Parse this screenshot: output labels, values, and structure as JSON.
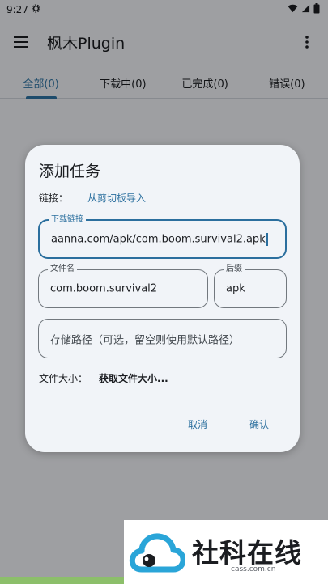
{
  "status": {
    "time": "9:27"
  },
  "appbar": {
    "title": "枫木Plugin"
  },
  "tabs": [
    {
      "label": "全部(0)"
    },
    {
      "label": "下载中(0)"
    },
    {
      "label": "已完成(0)"
    },
    {
      "label": "错误(0)"
    }
  ],
  "dialog": {
    "title": "添加任务",
    "link_label": "链接：",
    "link_action": "从剪切板导入",
    "url_field": {
      "label": "下载链接",
      "value": "aanna.com/apk/com.boom.survival2.apk"
    },
    "filename_field": {
      "label": "文件名",
      "value": "com.boom.survival2"
    },
    "ext_field": {
      "label": "后缀",
      "value": "apk"
    },
    "path_field": {
      "placeholder": "存储路径（可选，留空则使用默认路径）"
    },
    "size_label": "文件大小：",
    "size_value": "获取文件大小...",
    "cancel_label": "取消",
    "confirm_label": "确认"
  },
  "watermark": {
    "brand": "社科在线",
    "domain": "cass.com.cn"
  },
  "colors": {
    "accent": "#2b6f9e",
    "scrim": "rgba(0,0,0,0.32)",
    "dialog_bg": "#f1f4f8"
  }
}
